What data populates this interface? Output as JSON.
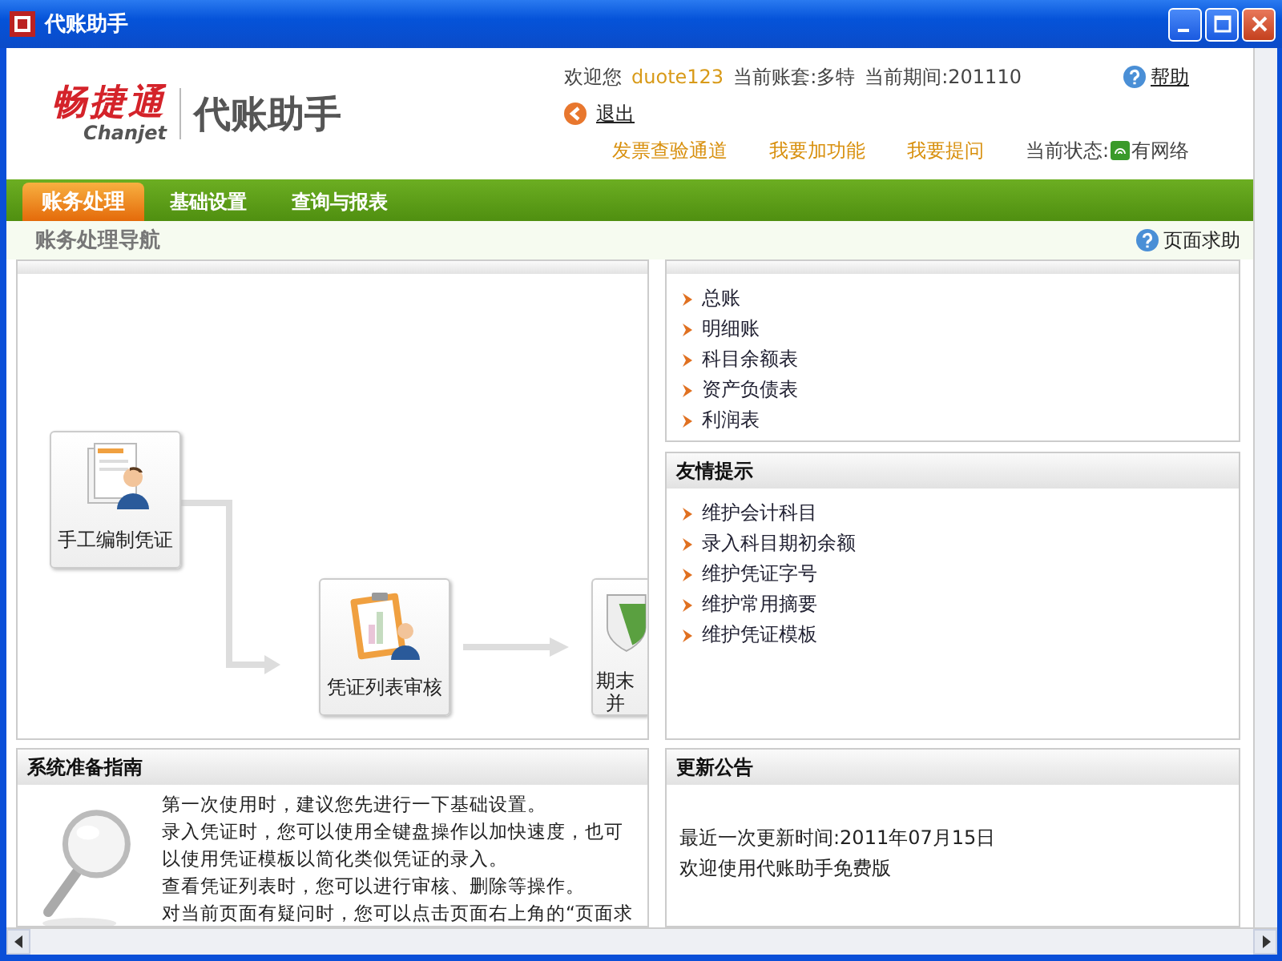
{
  "window": {
    "title": "代账助手"
  },
  "header": {
    "logo_brand": "畅捷通",
    "logo_sub": "Chanjet",
    "logo_product": "代账助手",
    "welcome": "欢迎您",
    "user": "duote123",
    "account": "当前账套:多特",
    "period": "当前期间:201110",
    "help": "帮助",
    "logout": "退出",
    "links": [
      "发票查验通道",
      "我要加功能",
      "我要提问"
    ],
    "status_label": "当前状态:",
    "status": "有网络"
  },
  "tabs": [
    {
      "label": "账务处理",
      "selected": true
    },
    {
      "label": "基础设置",
      "selected": false
    },
    {
      "label": "查询与报表",
      "selected": false
    }
  ],
  "subheader": {
    "title": "账务处理导航",
    "help": "页面求助"
  },
  "flow": {
    "nodes": [
      {
        "kind": "voucher",
        "lines": [
          "手工编制凭证"
        ]
      },
      {
        "kind": "review",
        "lines": [
          "凭证列表审核"
        ]
      },
      {
        "kind": "closing",
        "lines": [
          "期末",
          "并"
        ]
      }
    ]
  },
  "reports": {
    "items": [
      "总账",
      "明细账",
      "科目余额表",
      "资产负债表",
      "利润表"
    ]
  },
  "tips": {
    "title": "友情提示",
    "items": [
      "维护会计科目",
      "录入科目期初余额",
      "维护凭证字号",
      "维护常用摘要",
      "维护凭证模板"
    ]
  },
  "guide": {
    "title": "系统准备指南",
    "lines": [
      "第一次使用时，建议您先进行一下基础设置。",
      "录入凭证时，您可以使用全键盘操作以加快速度，也可以使用凭证模板以简化类似凭证的录入。",
      "查看凭证列表时，您可以进行审核、删除等操作。",
      "对当前页面有疑问时，您可以点击页面右上角的“页面求"
    ]
  },
  "news": {
    "title": "更新公告",
    "lines": [
      "最近一次更新时间:2011年07月15日",
      "欢迎使用代账助手免费版"
    ]
  }
}
